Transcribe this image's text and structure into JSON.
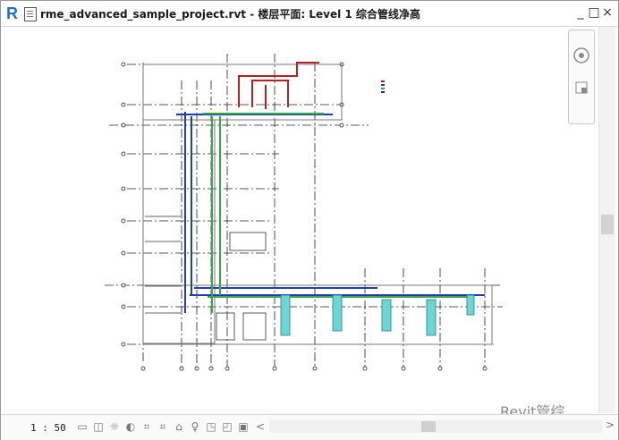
{
  "app": {
    "logo": "R",
    "title": "rme_advanced_sample_project.rvt - 楼层平面: Level 1 综合管线净高"
  },
  "window_controls": {
    "minimize": "_",
    "maximize": "□",
    "close": "×"
  },
  "status": {
    "scale": "1 : 50",
    "scroll_left": "<",
    "scroll_right": ">",
    "scroll_down": "⌄"
  },
  "watermark": {
    "text": "Revit管综"
  },
  "colors": {
    "pipe_blue": "#1f3fb0",
    "pipe_green": "#3aa64a",
    "pipe_red": "#b22222",
    "cyan": "#4fc6c6",
    "grid": "#222222"
  }
}
